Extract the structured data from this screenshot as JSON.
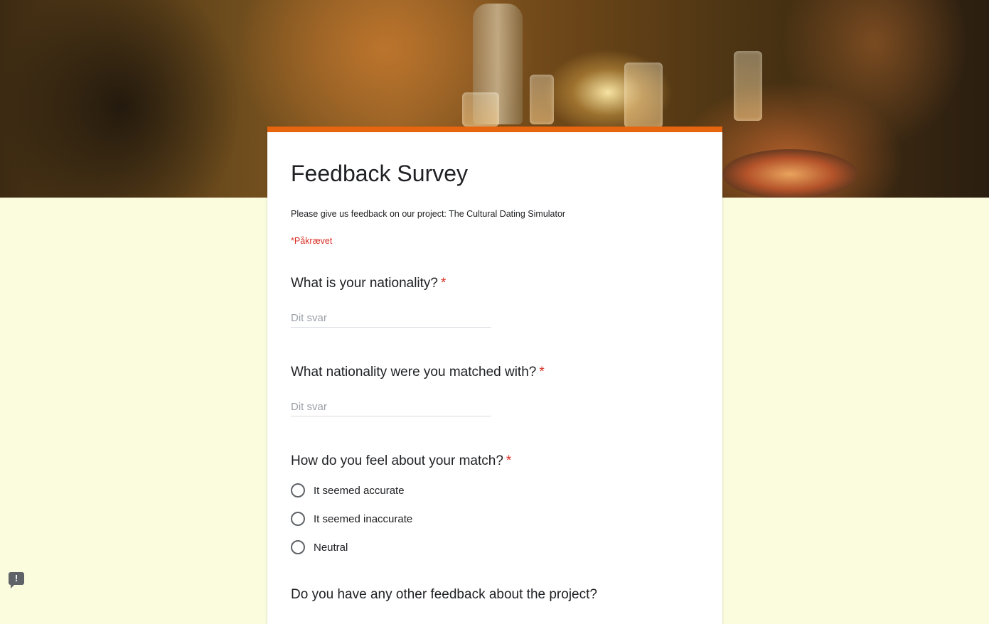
{
  "form": {
    "title": "Feedback Survey",
    "description": "Please give us feedback on our project: The Cultural Dating Simulator",
    "required_note": "*Påkrævet",
    "accent_color": "#e8650f",
    "background_color": "#fbfbde"
  },
  "questions": [
    {
      "title": "What is your nationality?",
      "required_marker": "*",
      "type": "short-answer",
      "placeholder": "Dit svar",
      "value": ""
    },
    {
      "title": "What nationality were you matched with?",
      "required_marker": "*",
      "type": "short-answer",
      "placeholder": "Dit svar",
      "value": ""
    },
    {
      "title": "How do you feel about your match?",
      "required_marker": "*",
      "type": "multiple-choice",
      "options": [
        "It seemed accurate",
        "It seemed inaccurate",
        "Neutral"
      ]
    },
    {
      "title": "Do you have any other feedback about the project?",
      "type": "paragraph"
    }
  ],
  "report_button": {
    "icon": "report-icon",
    "glyph": "!"
  }
}
